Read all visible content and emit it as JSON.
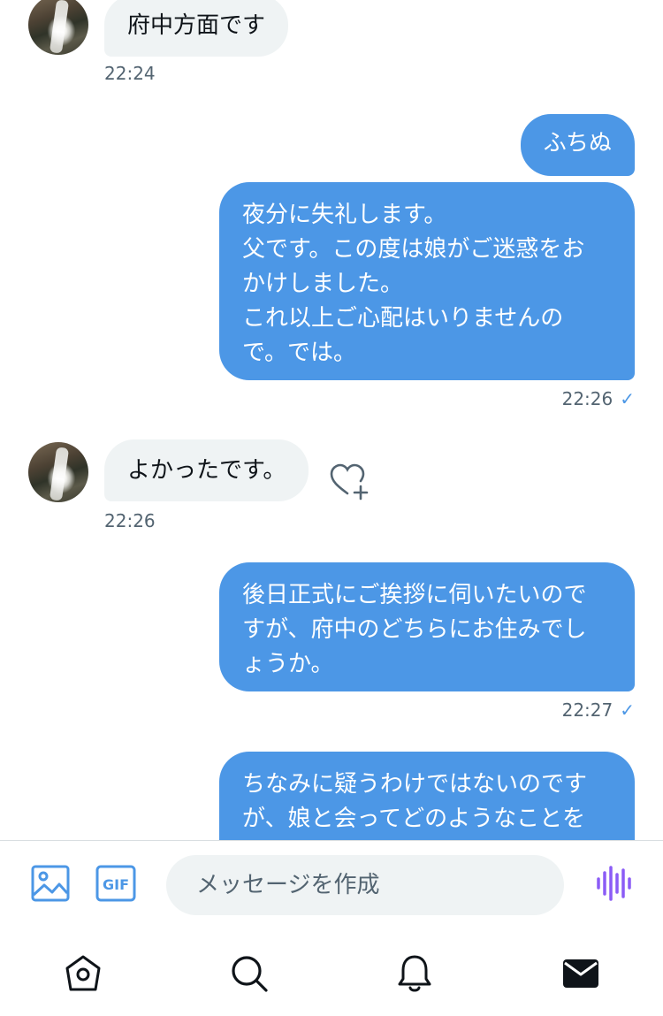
{
  "messages": [
    {
      "side": "in",
      "text": "府中方面です",
      "time": "22:24"
    },
    {
      "side": "out",
      "text": "ふちぬ"
    },
    {
      "side": "out",
      "lines": [
        "夜分に失礼します。",
        "父です。この度は娘がご迷惑をお",
        "かけしました。",
        "これ以上ご心配はいりませんの",
        "で。では。"
      ],
      "time": "22:26"
    },
    {
      "side": "in",
      "text": "よかったです。",
      "time": "22:26"
    },
    {
      "side": "out",
      "lines": [
        "後日正式にご挨拶に伺いたいので",
        "すが、府中のどちらにお住みでし",
        "ょうか。"
      ],
      "time": "22:27"
    },
    {
      "side": "out",
      "lines": [
        "ちなみに疑うわけではないのです",
        "が、娘と会ってどのようなことを"
      ]
    }
  ],
  "composer": {
    "placeholder": "メッセージを作成",
    "gif_label": "GIF"
  },
  "colors": {
    "outgoing_bubble": "#4c97e6",
    "incoming_bubble": "#eff3f4",
    "accent": "#4c97e6",
    "voice_icon": "#8b5cf6"
  },
  "icons": {
    "image": "image-icon",
    "gif": "gif-icon",
    "voice": "voice-wave-icon",
    "react": "heart-plus-icon",
    "home": "home-icon",
    "search": "search-icon",
    "notifications": "bell-icon",
    "messages": "mail-icon"
  },
  "tabs": [
    "home",
    "search",
    "notifications",
    "messages"
  ],
  "active_tab": "messages"
}
